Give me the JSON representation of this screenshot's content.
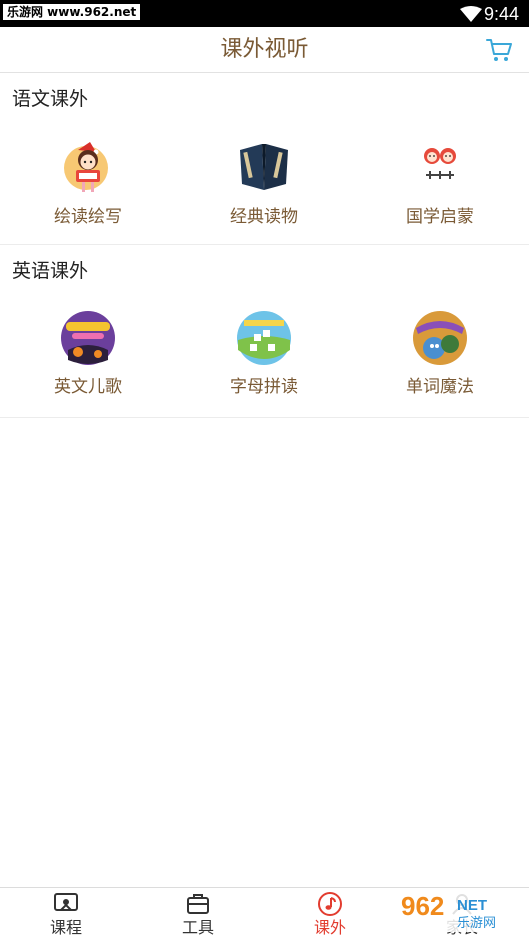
{
  "status_bar": {
    "watermark": "乐游网 www.962.net",
    "time": "9:44"
  },
  "header": {
    "title": "课外视听",
    "cart_icon": "cart-icon"
  },
  "sections": [
    {
      "title": "语文课外",
      "items": [
        {
          "label": "绘读绘写",
          "icon": "cartoon-girl-reading-icon"
        },
        {
          "label": "经典读物",
          "icon": "classic-book-icon"
        },
        {
          "label": "国学启蒙",
          "icon": "tongxueguan-logo-icon"
        }
      ]
    },
    {
      "title": "英语课外",
      "items": [
        {
          "label": "英文儿歌",
          "icon": "super-simple-songs-icon"
        },
        {
          "label": "字母拼读",
          "icon": "alphabet-phonics-icon"
        },
        {
          "label": "单词魔法",
          "icon": "wallykazam-icon"
        }
      ]
    }
  ],
  "tabbar": {
    "tabs": [
      {
        "label": "课程",
        "icon": "course-icon",
        "active": false
      },
      {
        "label": "工具",
        "icon": "toolbox-icon",
        "active": false
      },
      {
        "label": "课外",
        "icon": "music-note-icon",
        "active": true
      },
      {
        "label": "家长",
        "icon": "parent-icon",
        "active": false
      }
    ],
    "active_color": "#e23c2f"
  },
  "watermark_logo": {
    "text_big": "962",
    "text_small": "NET",
    "text_cn": "乐游网"
  },
  "colors": {
    "title": "#7a5a35",
    "label": "#7a5a35",
    "cart": "#3aa7d8",
    "active_tab": "#e23c2f"
  }
}
